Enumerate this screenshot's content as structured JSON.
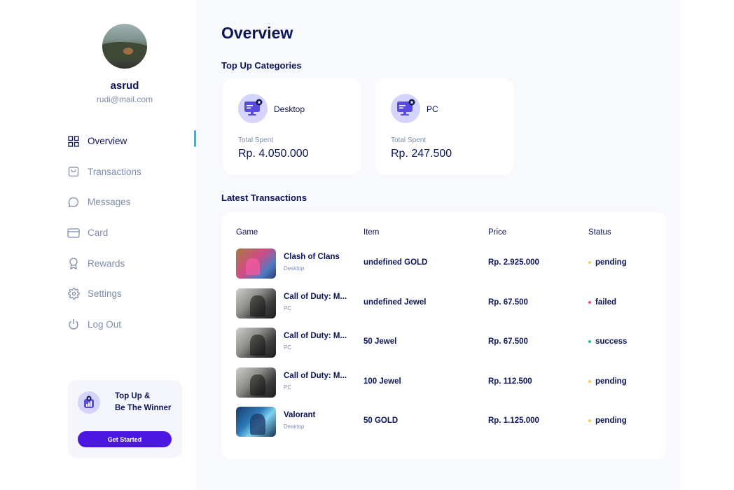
{
  "profile": {
    "name": "asrud",
    "email": "rudi@mail.com"
  },
  "nav": {
    "items": [
      {
        "label": "Overview",
        "icon": "grid-icon",
        "active": true
      },
      {
        "label": "Transactions",
        "icon": "bag-icon",
        "active": false
      },
      {
        "label": "Messages",
        "icon": "chat-icon",
        "active": false
      },
      {
        "label": "Card",
        "icon": "card-icon",
        "active": false
      },
      {
        "label": "Rewards",
        "icon": "award-icon",
        "active": false
      },
      {
        "label": "Settings",
        "icon": "gear-icon",
        "active": false
      },
      {
        "label": "Log Out",
        "icon": "power-icon",
        "active": false
      }
    ]
  },
  "promo": {
    "line1": "Top Up &",
    "line2": "Be The Winner",
    "button": "Get Started"
  },
  "main": {
    "title": "Overview",
    "categories_title": "Top Up Categories",
    "categories": [
      {
        "name": "Desktop",
        "label": "Total Spent",
        "value": "Rp. 4.050.000"
      },
      {
        "name": "PC",
        "label": "Total Spent",
        "value": "Rp. 247.500"
      }
    ],
    "transactions_title": "Latest Transactions",
    "table": {
      "headers": {
        "game": "Game",
        "item": "Item",
        "price": "Price",
        "status": "Status"
      },
      "rows": [
        {
          "game": "Clash of Clans",
          "platform": "Desktop",
          "item": "undefined GOLD",
          "price": "Rp. 2.925.000",
          "status": "pending"
        },
        {
          "game": "Call of Duty: M...",
          "platform": "PC",
          "item": "undefined Jewel",
          "price": "Rp. 67.500",
          "status": "failed"
        },
        {
          "game": "Call of Duty: M...",
          "platform": "PC",
          "item": "50 Jewel",
          "price": "Rp. 67.500",
          "status": "success"
        },
        {
          "game": "Call of Duty: M...",
          "platform": "PC",
          "item": "100 Jewel",
          "price": "Rp. 112.500",
          "status": "pending"
        },
        {
          "game": "Valorant",
          "platform": "Desktop",
          "item": "50 GOLD",
          "price": "Rp. 1.125.000",
          "status": "pending"
        }
      ]
    }
  },
  "colors": {
    "accent": "#4d17e2",
    "active_indicator": "#1abcfe",
    "pending": "#feca57",
    "failed": "#ff4b7d",
    "success": "#1abc9c",
    "text_primary": "#0c145a",
    "text_secondary": "#7e8cac"
  }
}
